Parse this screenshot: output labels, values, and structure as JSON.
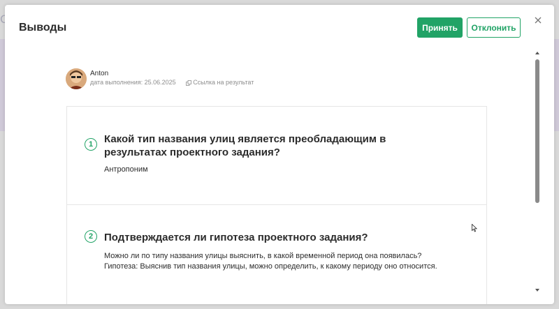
{
  "backdrop": {
    "logo_fragment": "C",
    "right_fragment": ""
  },
  "modal": {
    "title": "Выводы",
    "accept_label": "Принять",
    "reject_label": "Отклонить"
  },
  "author": {
    "name": "Anton",
    "date_text": "дата выполнения: 25.06.2025",
    "link_text": "Ссылка на результат"
  },
  "questions": [
    {
      "number": "1",
      "title": "Какой тип названия улиц является преобладающим в результатах проектного задания?",
      "answer": "Антропоним"
    },
    {
      "number": "2",
      "title": "Подтверждается ли гипотеза проектного задания?",
      "answer_line1": "Можно ли по типу названия улицы выяснить, в какой временной период она появилась?",
      "answer_line2": "Гипотеза: Выяснив тип названия улицы, можно определить, к какому периоду оно относится."
    }
  ],
  "colors": {
    "accent": "#21a366",
    "text": "#2b2b2b",
    "muted": "#8d8d8d"
  }
}
